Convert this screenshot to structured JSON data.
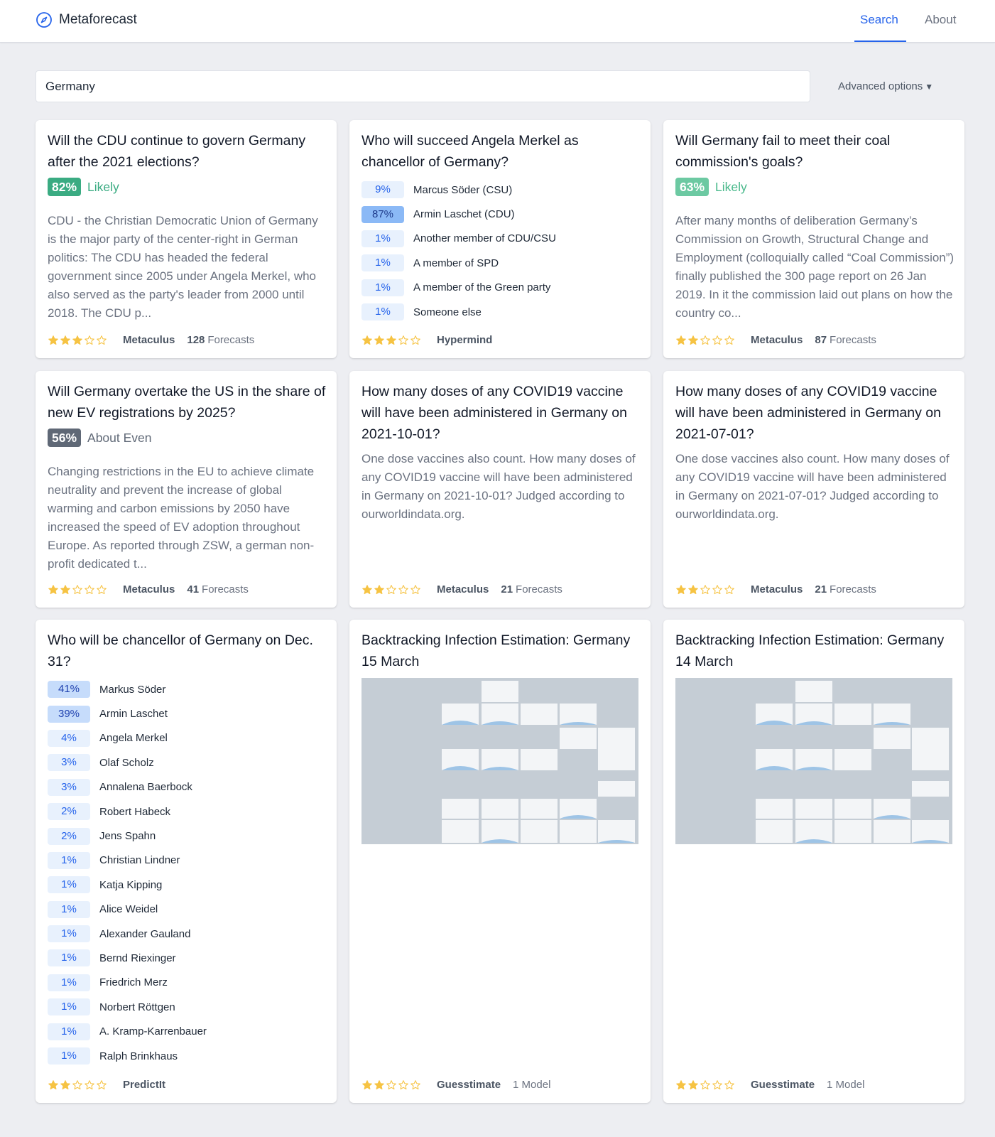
{
  "header": {
    "brand": "Metaforecast",
    "tabs": [
      {
        "label": "Search",
        "active": true
      },
      {
        "label": "About",
        "active": false
      }
    ]
  },
  "search": {
    "value": "Germany",
    "advanced_label": "Advanced options"
  },
  "colors": {
    "accent": "#2563eb",
    "likely": "#3aab82",
    "star": "#f6c343"
  },
  "cards": [
    {
      "title": "Will the CDU continue to govern Germany after the 2021 elections?",
      "probability": "82%",
      "probability_label": "Likely",
      "description": "CDU - the Christian Democratic Union of Germany is the major party of the center-right in German politics: The CDU has headed the federal government since 2005 under Angela Merkel, who also served as the party's leader from 2000 until 2018. The CDU p...",
      "stars": 3,
      "platform": "Metaculus",
      "forecasts": "128",
      "forecasts_label": "Forecasts"
    },
    {
      "title": "Who will succeed Angela Merkel as chancellor of Germany?",
      "options": [
        {
          "pct": "9%",
          "name": "Marcus Söder (CSU)"
        },
        {
          "pct": "87%",
          "name": "Armin Laschet (CDU)"
        },
        {
          "pct": "1%",
          "name": "Another member of CDU/CSU"
        },
        {
          "pct": "1%",
          "name": "A member of SPD"
        },
        {
          "pct": "1%",
          "name": "A member of the Green party"
        },
        {
          "pct": "1%",
          "name": "Someone else"
        }
      ],
      "stars": 3,
      "platform": "Hypermind"
    },
    {
      "title": "Will Germany fail to meet their coal commission's goals?",
      "probability": "63%",
      "probability_label": "Likely",
      "description": "After many months of deliberation Germany’s Commission on Growth, Structural Change and Employment (colloquially called “Coal Commission”) finally published the 300 page report on 26 Jan 2019. In it the commission laid out plans on how the country co...",
      "stars": 2,
      "platform": "Metaculus",
      "forecasts": "87",
      "forecasts_label": "Forecasts"
    },
    {
      "title": "Will Germany overtake the US in the share of new EV registrations by 2025?",
      "probability": "56%",
      "probability_label": "About Even",
      "description": "Changing restrictions in the EU to achieve climate neutrality and prevent the increase of global warming and carbon emissions by 2050 have increased the speed of EV adoption throughout Europe. As reported through ZSW, a german non-profit dedicated t...",
      "stars": 2,
      "platform": "Metaculus",
      "forecasts": "41",
      "forecasts_label": "Forecasts"
    },
    {
      "title": "How many doses of any COVID19 vaccine will have been administered in Germany on 2021-10-01?",
      "description": "One dose vaccines also count. How many doses of any COVID19 vaccine will have been administered in Germany on 2021-10-01? Judged according to ourworldindata.org.",
      "stars": 2,
      "platform": "Metaculus",
      "forecasts": "21",
      "forecasts_label": "Forecasts"
    },
    {
      "title": "How many doses of any COVID19 vaccine will have been administered in Germany on 2021-07-01?",
      "description": "One dose vaccines also count. How many doses of any COVID19 vaccine will have been administered in Germany on 2021-07-01? Judged according to ourworldindata.org.",
      "stars": 2,
      "platform": "Metaculus",
      "forecasts": "21",
      "forecasts_label": "Forecasts"
    },
    {
      "title": "Who will be chancellor of Germany on Dec. 31?",
      "options": [
        {
          "pct": "41%",
          "name": "Markus Söder"
        },
        {
          "pct": "39%",
          "name": "Armin Laschet"
        },
        {
          "pct": "4%",
          "name": "Angela Merkel"
        },
        {
          "pct": "3%",
          "name": "Olaf Scholz"
        },
        {
          "pct": "3%",
          "name": "Annalena Baerbock"
        },
        {
          "pct": "2%",
          "name": "Robert Habeck"
        },
        {
          "pct": "2%",
          "name": "Jens Spahn"
        },
        {
          "pct": "1%",
          "name": "Christian Lindner"
        },
        {
          "pct": "1%",
          "name": "Katja Kipping"
        },
        {
          "pct": "1%",
          "name": "Alice Weidel"
        },
        {
          "pct": "1%",
          "name": "Alexander Gauland"
        },
        {
          "pct": "1%",
          "name": "Bernd Riexinger"
        },
        {
          "pct": "1%",
          "name": "Friedrich Merz"
        },
        {
          "pct": "1%",
          "name": "Norbert Röttgen"
        },
        {
          "pct": "1%",
          "name": "A. Kramp-Karrenbauer"
        },
        {
          "pct": "1%",
          "name": "Ralph Brinkhaus"
        }
      ],
      "stars": 2,
      "platform": "PredictIt"
    },
    {
      "title": "Backtracking Infection Estimation: Germany 15 March",
      "stars": 2,
      "platform": "Guesstimate",
      "models": "1 Model"
    },
    {
      "title": "Backtracking Infection Estimation: Germany 14 March",
      "stars": 2,
      "platform": "Guesstimate",
      "models": "1 Model"
    }
  ]
}
